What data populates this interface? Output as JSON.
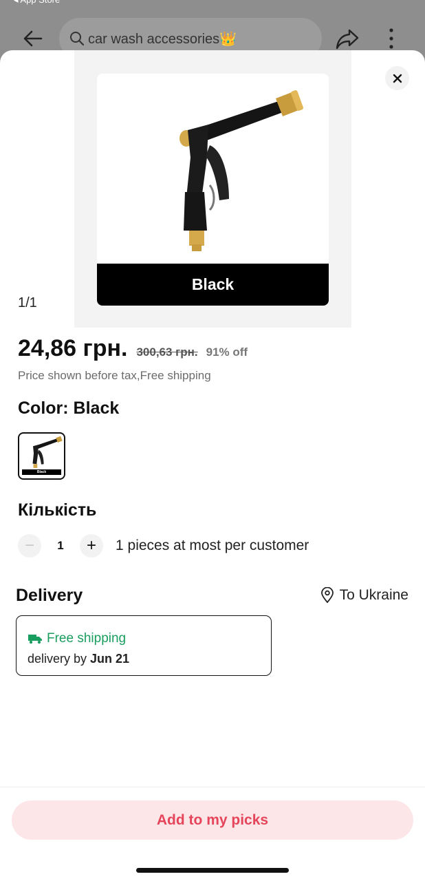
{
  "status_bar": {
    "back_app": "◂ App Store"
  },
  "top_bar": {
    "search_text": "car wash accessories👑"
  },
  "gallery": {
    "banner_label": "Black",
    "counter": "1/1"
  },
  "price": {
    "current": "24,86 грн.",
    "original": "300,63 грн.",
    "discount": "91% off",
    "note": "Price shown before tax,Free shipping"
  },
  "color": {
    "label": "Color: Black",
    "options": [
      {
        "name": "Black",
        "selected": true
      }
    ]
  },
  "quantity": {
    "label": "Кількість",
    "minus": "−",
    "value": "1",
    "plus": "+",
    "limit_text": "1 pieces at most per customer"
  },
  "delivery": {
    "label": "Delivery",
    "destination": "To Ukraine",
    "shipping_title": "Free shipping",
    "date_prefix": "delivery by",
    "date": "Jun 21"
  },
  "actions": {
    "add_label": "Add to my picks"
  },
  "colors": {
    "accent": "#e5445a",
    "accent_bg": "#fde6e8",
    "ship_green": "#1a9e5f"
  },
  "icons": [
    "chevron-left-icon",
    "search-icon",
    "share-icon",
    "more-icon",
    "close-icon",
    "location-pin-icon",
    "truck-icon"
  ]
}
